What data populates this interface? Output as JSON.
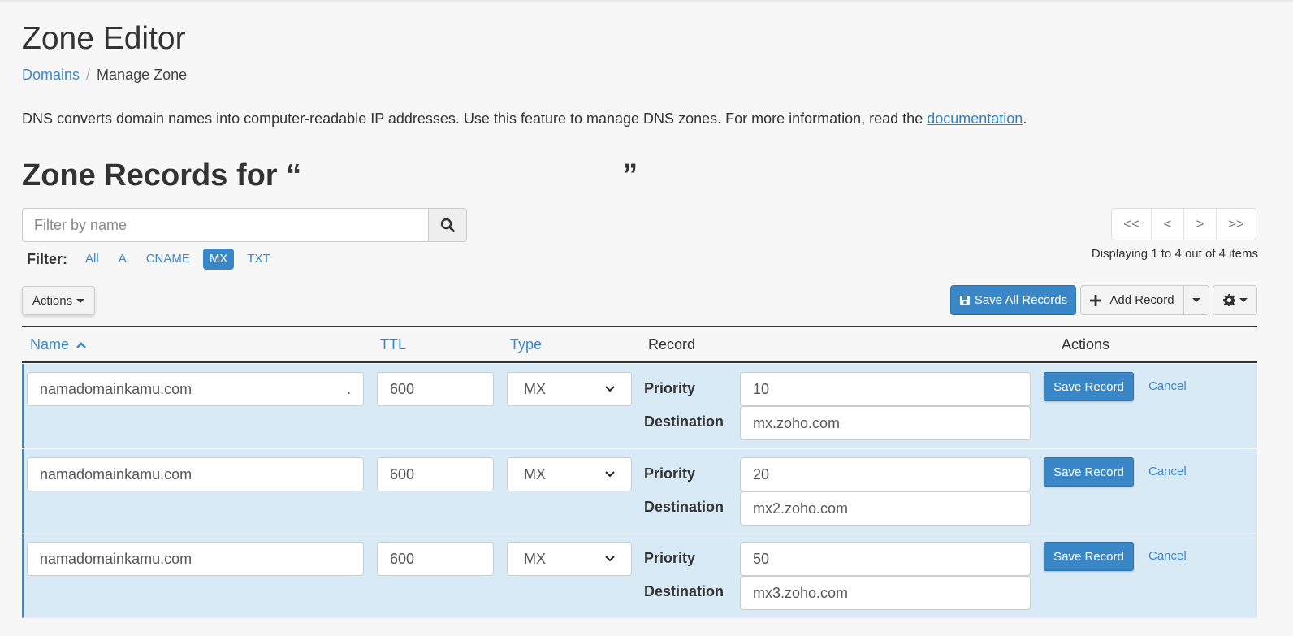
{
  "page": {
    "title": "Zone Editor",
    "breadcrumb": {
      "link": "Domains",
      "separator": "/",
      "current": "Manage Zone"
    },
    "description": {
      "text": "DNS converts domain names into computer-readable IP addresses. Use this feature to manage DNS zones. For more information, read the ",
      "link": "documentation",
      "end": "."
    },
    "section_title_open": "Zone Records for “",
    "section_title_close": "”"
  },
  "search": {
    "placeholder": "Filter by name",
    "icon": "search-icon"
  },
  "filter": {
    "label": "Filter:",
    "options": [
      "All",
      "A",
      "CNAME",
      "MX",
      "TXT"
    ],
    "active": "MX"
  },
  "pagination": {
    "first": "<<",
    "prev": "<",
    "next": ">",
    "last": ">>",
    "summary": "Displaying 1 to 4 out of 4 items"
  },
  "toolbar": {
    "actions_label": "Actions",
    "save_all_label": "Save All Records",
    "add_record_label": "Add Record",
    "icons": [
      "save-icon",
      "plus-icon",
      "gear-icon",
      "chevron-down-icon"
    ]
  },
  "table": {
    "headers": {
      "name": "Name",
      "ttl": "TTL",
      "type": "Type",
      "record": "Record",
      "actions": "Actions"
    },
    "priority_label": "Priority",
    "destination_label": "Destination",
    "save_label": "Save Record",
    "cancel_label": "Cancel",
    "rows": [
      {
        "name": "namadomainkamu.com",
        "name_suffix": ".",
        "ttl": "600",
        "type": "MX",
        "priority": "10",
        "destination": "mx.zoho.com"
      },
      {
        "name": "namadomainkamu.com",
        "name_suffix": "",
        "ttl": "600",
        "type": "MX",
        "priority": "20",
        "destination": "mx2.zoho.com"
      },
      {
        "name": "namadomainkamu.com",
        "name_suffix": "",
        "ttl": "600",
        "type": "MX",
        "priority": "50",
        "destination": "mx3.zoho.com"
      }
    ]
  },
  "colors": {
    "accent": "#3a87c8",
    "row_bg": "#d9eaf7",
    "page_bg": "#f7f7f7"
  }
}
